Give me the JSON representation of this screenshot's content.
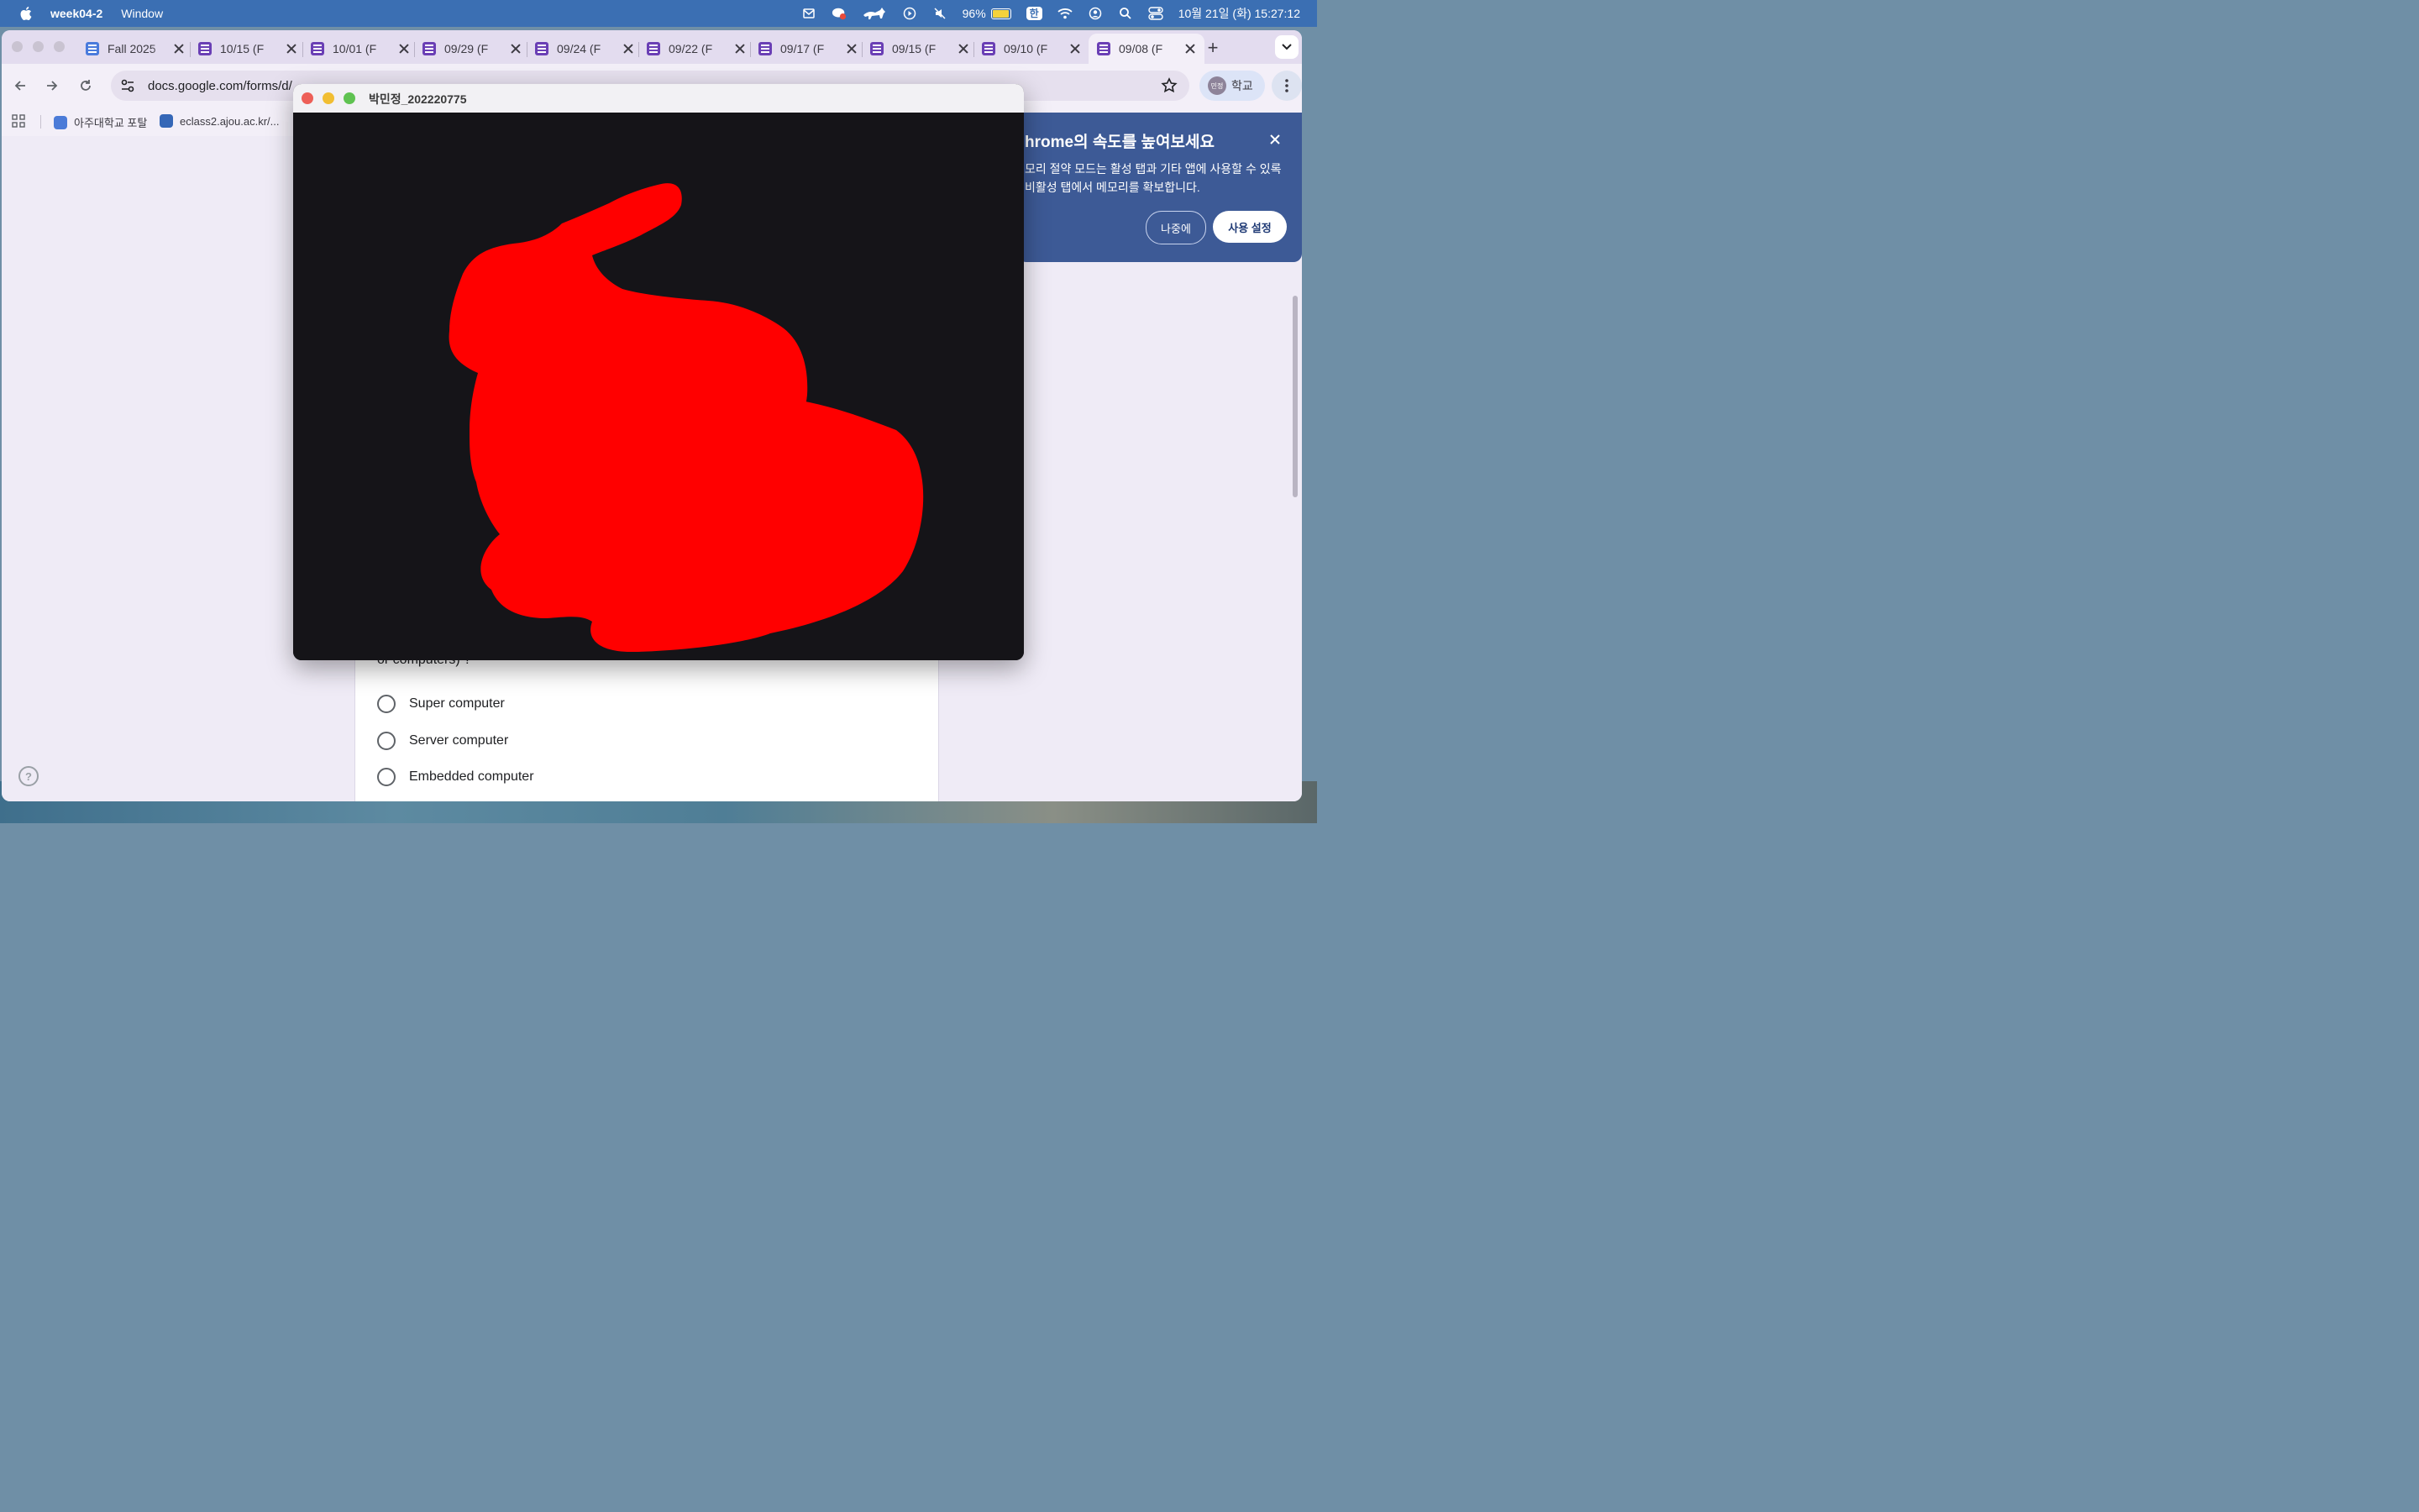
{
  "menubar": {
    "app_name": "week04-2",
    "menu": "Window",
    "battery": "96%",
    "battery_level": 0.96,
    "ime": "한",
    "clock": "10월 21일 (화) 15:27:12",
    "status_icons": [
      "mail-icon",
      "chat-badge-icon",
      "cat-icon",
      "play-circle-icon",
      "mute-icon",
      "battery-icon",
      "input-source-icon",
      "wifi-icon",
      "user-circle-icon",
      "spotlight-search-icon",
      "control-center-icon"
    ]
  },
  "chrome": {
    "tabs": [
      {
        "title": "Fall 2025",
        "icon": "google-docs-icon",
        "color": "#4a7bdc"
      },
      {
        "title": "10/15 (F",
        "icon": "google-forms-icon",
        "color": "#6a3fb5"
      },
      {
        "title": "10/01 (F",
        "icon": "google-forms-icon",
        "color": "#6a3fb5"
      },
      {
        "title": "09/29 (F",
        "icon": "google-forms-icon",
        "color": "#6a3fb5"
      },
      {
        "title": "09/24 (F",
        "icon": "google-forms-icon",
        "color": "#6a3fb5"
      },
      {
        "title": "09/22 (F",
        "icon": "google-forms-icon",
        "color": "#6a3fb5"
      },
      {
        "title": "09/17 (F",
        "icon": "google-forms-icon",
        "color": "#6a3fb5"
      },
      {
        "title": "09/15 (F",
        "icon": "google-forms-icon",
        "color": "#6a3fb5"
      },
      {
        "title": "09/10 (F",
        "icon": "google-forms-icon",
        "color": "#6a3fb5"
      },
      {
        "title": "09/08 (F",
        "icon": "google-forms-icon",
        "color": "#6a3fb5",
        "active": true
      }
    ],
    "url": "docs.google.com/forms/d/",
    "profile_label": "학교",
    "profile_avatar_text": "민정",
    "bookmarks": [
      {
        "label": "아주대학교 포탈",
        "icon": "ajou-icon"
      },
      {
        "label": "eclass2.ajou.ac.kr/...",
        "icon": "eclass-icon"
      }
    ]
  },
  "promo": {
    "title": "hrome의 속도를 높여보세요",
    "body": "모리 절약 모드는 활성 탭과 기타 앱에 사용할 수 있록 비활성 탭에서 메모리를 확보합니다.",
    "later_label": "나중에",
    "enable_label": "사용 설정"
  },
  "form": {
    "question_tail": "or computers) ?",
    "options": [
      "Super computer",
      "Server computer",
      "Embedded computer"
    ]
  },
  "glwindow": {
    "title": "박민정_202220775",
    "fill_color": "#ff0000",
    "background_color": "#151418"
  }
}
